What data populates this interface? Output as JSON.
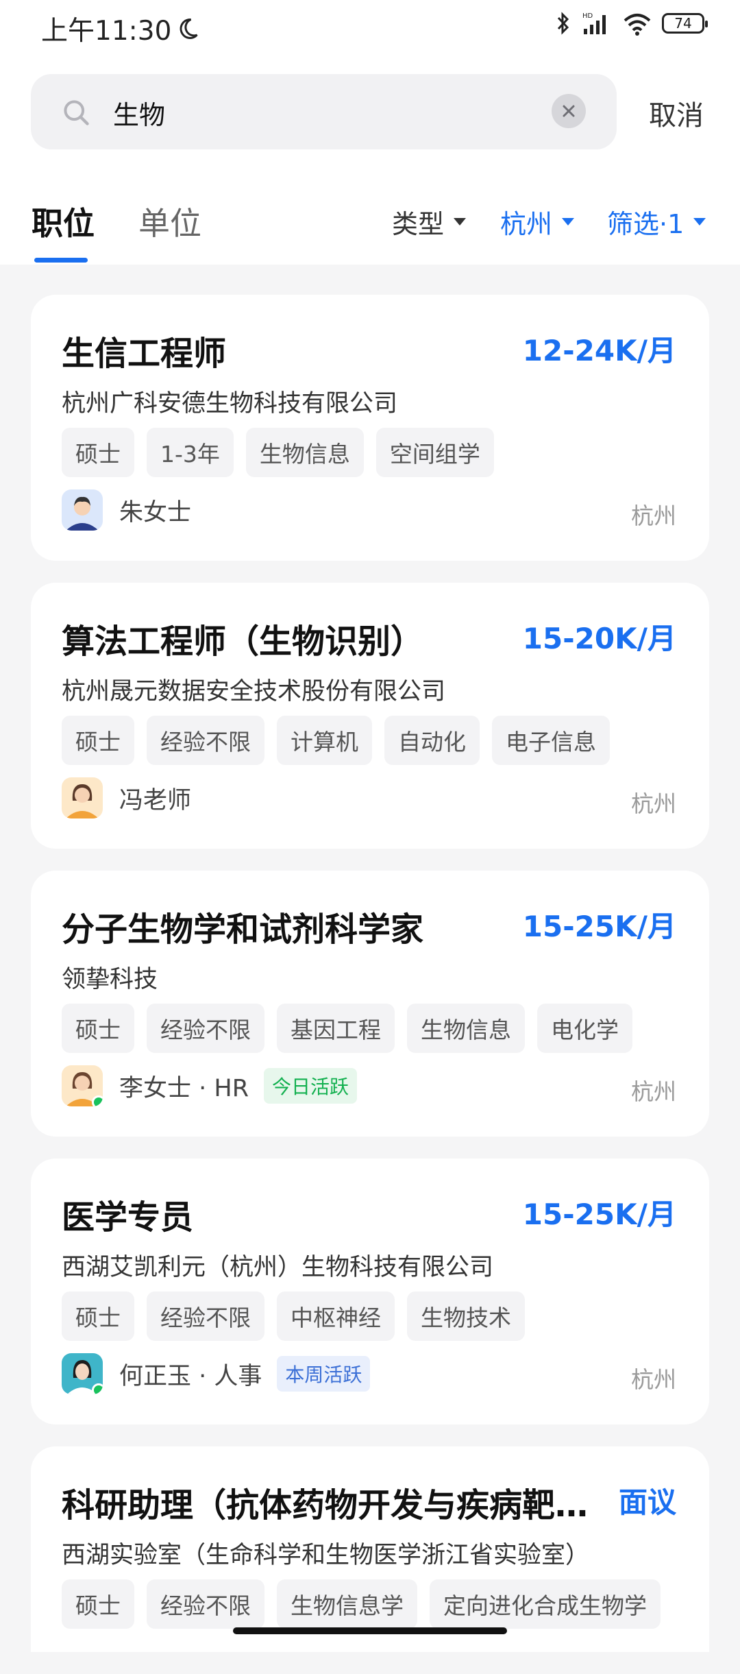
{
  "status_bar": {
    "time": "上午11:30",
    "battery": "74",
    "network": "HD"
  },
  "search": {
    "query": "生物",
    "cancel_label": "取消"
  },
  "tabs": [
    {
      "label": "职位"
    },
    {
      "label": "单位"
    }
  ],
  "filters": {
    "type_label": "类型",
    "city_label": "杭州",
    "filter_label": "筛选·1"
  },
  "colors": {
    "accent": "#1a6ff0",
    "online": "#19c25c"
  },
  "jobs": [
    {
      "title": "生信工程师",
      "salary": "12-24K/月",
      "company": "杭州广科安德生物科技有限公司",
      "tags": [
        "硕士",
        "1-3年",
        "生物信息",
        "空间组学"
      ],
      "recruiter": "朱女士",
      "badge": "",
      "city": "杭州"
    },
    {
      "title": "算法工程师（生物识别）",
      "salary": "15-20K/月",
      "company": "杭州晟元数据安全技术股份有限公司",
      "tags": [
        "硕士",
        "经验不限",
        "计算机",
        "自动化",
        "电子信息"
      ],
      "recruiter": "冯老师",
      "badge": "",
      "city": "杭州"
    },
    {
      "title": "分子生物学和试剂科学家",
      "salary": "15-25K/月",
      "company": "领挚科技",
      "tags": [
        "硕士",
        "经验不限",
        "基因工程",
        "生物信息",
        "电化学"
      ],
      "recruiter": "李女士 · HR",
      "badge": "今日活跃",
      "city": "杭州"
    },
    {
      "title": "医学专员",
      "salary": "15-25K/月",
      "company": "西湖艾凯利元（杭州）生物科技有限公司",
      "tags": [
        "硕士",
        "经验不限",
        "中枢神经",
        "生物技术"
      ],
      "recruiter": "何正玉 · 人事",
      "badge": "本周活跃",
      "city": "杭州"
    },
    {
      "title": "科研助理（抗体药物开发与疾病靶…",
      "salary": "面议",
      "company": "西湖实验室（生命科学和生物医学浙江省实验室）",
      "tags": [
        "硕士",
        "经验不限",
        "生物信息学",
        "定向进化合成生物学"
      ]
    }
  ]
}
